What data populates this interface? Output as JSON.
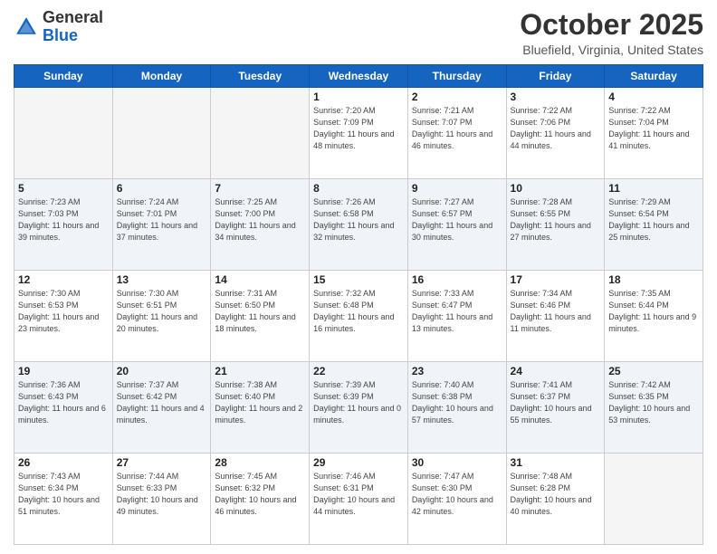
{
  "header": {
    "logo_general": "General",
    "logo_blue": "Blue",
    "month_title": "October 2025",
    "location": "Bluefield, Virginia, United States"
  },
  "days_of_week": [
    "Sunday",
    "Monday",
    "Tuesday",
    "Wednesday",
    "Thursday",
    "Friday",
    "Saturday"
  ],
  "weeks": [
    [
      {
        "day": "",
        "info": ""
      },
      {
        "day": "",
        "info": ""
      },
      {
        "day": "",
        "info": ""
      },
      {
        "day": "1",
        "info": "Sunrise: 7:20 AM\nSunset: 7:09 PM\nDaylight: 11 hours\nand 48 minutes."
      },
      {
        "day": "2",
        "info": "Sunrise: 7:21 AM\nSunset: 7:07 PM\nDaylight: 11 hours\nand 46 minutes."
      },
      {
        "day": "3",
        "info": "Sunrise: 7:22 AM\nSunset: 7:06 PM\nDaylight: 11 hours\nand 44 minutes."
      },
      {
        "day": "4",
        "info": "Sunrise: 7:22 AM\nSunset: 7:04 PM\nDaylight: 11 hours\nand 41 minutes."
      }
    ],
    [
      {
        "day": "5",
        "info": "Sunrise: 7:23 AM\nSunset: 7:03 PM\nDaylight: 11 hours\nand 39 minutes."
      },
      {
        "day": "6",
        "info": "Sunrise: 7:24 AM\nSunset: 7:01 PM\nDaylight: 11 hours\nand 37 minutes."
      },
      {
        "day": "7",
        "info": "Sunrise: 7:25 AM\nSunset: 7:00 PM\nDaylight: 11 hours\nand 34 minutes."
      },
      {
        "day": "8",
        "info": "Sunrise: 7:26 AM\nSunset: 6:58 PM\nDaylight: 11 hours\nand 32 minutes."
      },
      {
        "day": "9",
        "info": "Sunrise: 7:27 AM\nSunset: 6:57 PM\nDaylight: 11 hours\nand 30 minutes."
      },
      {
        "day": "10",
        "info": "Sunrise: 7:28 AM\nSunset: 6:55 PM\nDaylight: 11 hours\nand 27 minutes."
      },
      {
        "day": "11",
        "info": "Sunrise: 7:29 AM\nSunset: 6:54 PM\nDaylight: 11 hours\nand 25 minutes."
      }
    ],
    [
      {
        "day": "12",
        "info": "Sunrise: 7:30 AM\nSunset: 6:53 PM\nDaylight: 11 hours\nand 23 minutes."
      },
      {
        "day": "13",
        "info": "Sunrise: 7:30 AM\nSunset: 6:51 PM\nDaylight: 11 hours\nand 20 minutes."
      },
      {
        "day": "14",
        "info": "Sunrise: 7:31 AM\nSunset: 6:50 PM\nDaylight: 11 hours\nand 18 minutes."
      },
      {
        "day": "15",
        "info": "Sunrise: 7:32 AM\nSunset: 6:48 PM\nDaylight: 11 hours\nand 16 minutes."
      },
      {
        "day": "16",
        "info": "Sunrise: 7:33 AM\nSunset: 6:47 PM\nDaylight: 11 hours\nand 13 minutes."
      },
      {
        "day": "17",
        "info": "Sunrise: 7:34 AM\nSunset: 6:46 PM\nDaylight: 11 hours\nand 11 minutes."
      },
      {
        "day": "18",
        "info": "Sunrise: 7:35 AM\nSunset: 6:44 PM\nDaylight: 11 hours\nand 9 minutes."
      }
    ],
    [
      {
        "day": "19",
        "info": "Sunrise: 7:36 AM\nSunset: 6:43 PM\nDaylight: 11 hours\nand 6 minutes."
      },
      {
        "day": "20",
        "info": "Sunrise: 7:37 AM\nSunset: 6:42 PM\nDaylight: 11 hours\nand 4 minutes."
      },
      {
        "day": "21",
        "info": "Sunrise: 7:38 AM\nSunset: 6:40 PM\nDaylight: 11 hours\nand 2 minutes."
      },
      {
        "day": "22",
        "info": "Sunrise: 7:39 AM\nSunset: 6:39 PM\nDaylight: 11 hours\nand 0 minutes."
      },
      {
        "day": "23",
        "info": "Sunrise: 7:40 AM\nSunset: 6:38 PM\nDaylight: 10 hours\nand 57 minutes."
      },
      {
        "day": "24",
        "info": "Sunrise: 7:41 AM\nSunset: 6:37 PM\nDaylight: 10 hours\nand 55 minutes."
      },
      {
        "day": "25",
        "info": "Sunrise: 7:42 AM\nSunset: 6:35 PM\nDaylight: 10 hours\nand 53 minutes."
      }
    ],
    [
      {
        "day": "26",
        "info": "Sunrise: 7:43 AM\nSunset: 6:34 PM\nDaylight: 10 hours\nand 51 minutes."
      },
      {
        "day": "27",
        "info": "Sunrise: 7:44 AM\nSunset: 6:33 PM\nDaylight: 10 hours\nand 49 minutes."
      },
      {
        "day": "28",
        "info": "Sunrise: 7:45 AM\nSunset: 6:32 PM\nDaylight: 10 hours\nand 46 minutes."
      },
      {
        "day": "29",
        "info": "Sunrise: 7:46 AM\nSunset: 6:31 PM\nDaylight: 10 hours\nand 44 minutes."
      },
      {
        "day": "30",
        "info": "Sunrise: 7:47 AM\nSunset: 6:30 PM\nDaylight: 10 hours\nand 42 minutes."
      },
      {
        "day": "31",
        "info": "Sunrise: 7:48 AM\nSunset: 6:28 PM\nDaylight: 10 hours\nand 40 minutes."
      },
      {
        "day": "",
        "info": ""
      }
    ]
  ]
}
